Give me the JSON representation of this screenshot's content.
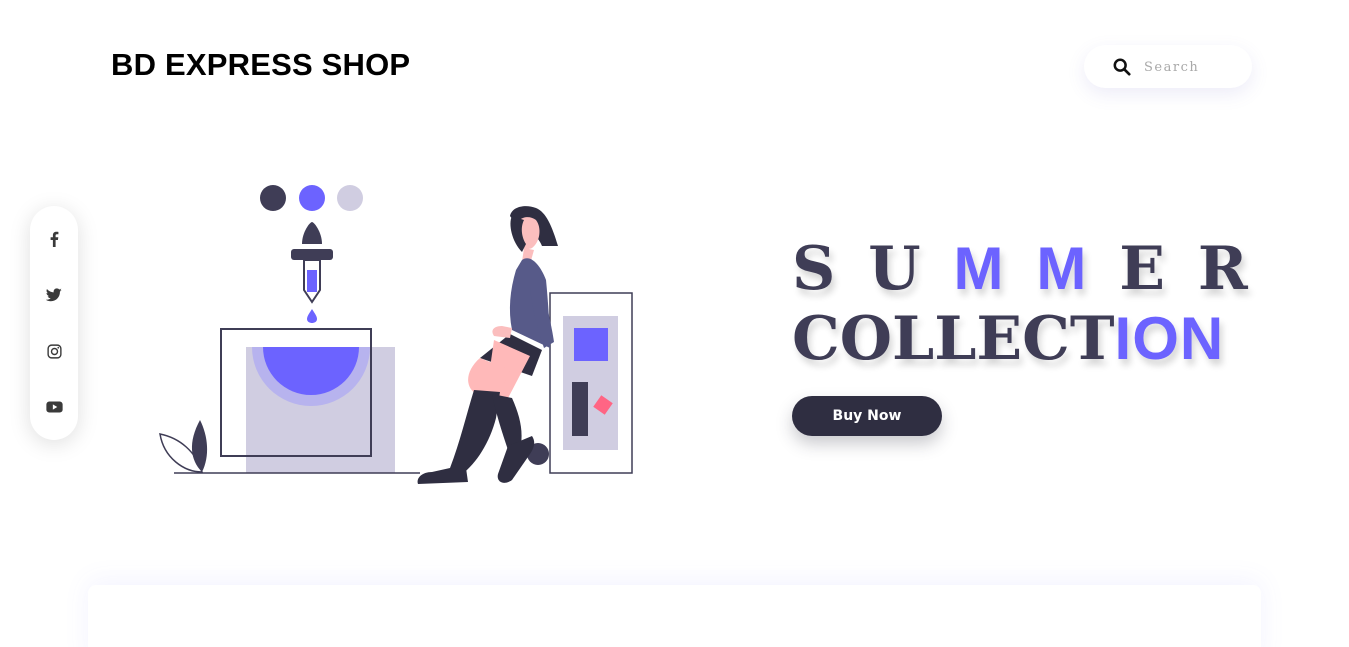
{
  "header": {
    "brand": "BD EXPRESS SHOP",
    "search": {
      "placeholder": "Search",
      "value": "",
      "icon": "search-icon"
    }
  },
  "social": {
    "items": [
      {
        "name": "facebook",
        "icon": "facebook-icon"
      },
      {
        "name": "twitter",
        "icon": "twitter-icon"
      },
      {
        "name": "instagram",
        "icon": "instagram-icon"
      },
      {
        "name": "youtube",
        "icon": "youtube-icon"
      }
    ]
  },
  "hero": {
    "line1_part1": [
      "S",
      "U"
    ],
    "line1_accent": [
      "M",
      "M"
    ],
    "line1_part2": [
      "E",
      "R"
    ],
    "line2_plain": "COLLECT",
    "line2_accent": "ION",
    "cta_label": "Buy Now",
    "illustration": "woman-with-color-dropper-illustration"
  },
  "colors": {
    "accent": "#6c63ff",
    "dark": "#2f2e41",
    "text_dark": "#3f3d56",
    "light_lavender": "#d0cde1",
    "pink": "#ff6584"
  }
}
